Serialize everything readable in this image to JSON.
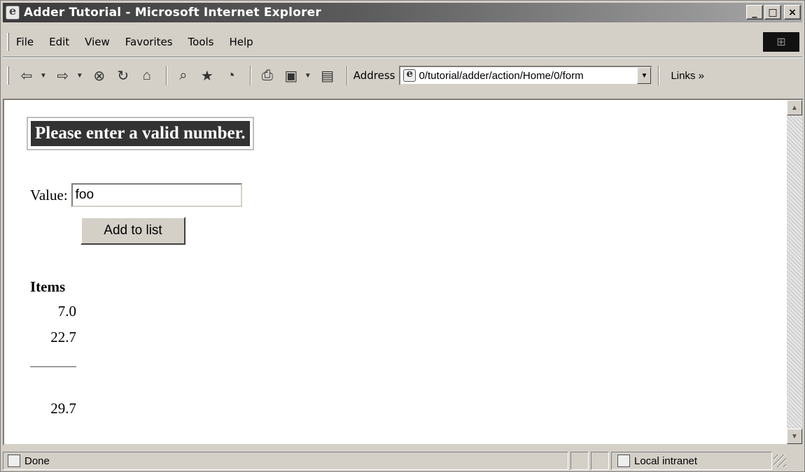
{
  "window": {
    "title": "Adder Tutorial - Microsoft Internet Explorer",
    "minimize_glyph": "_",
    "maximize_glyph": "□",
    "close_glyph": "×"
  },
  "menu": {
    "items": [
      "File",
      "Edit",
      "View",
      "Favorites",
      "Tools",
      "Help"
    ]
  },
  "toolbar": {
    "address_label": "Address",
    "address_value": "0/tutorial/adder/action/Home/0/form",
    "links_label": "Links »"
  },
  "page": {
    "error_message": "Please enter a valid number.",
    "value_label": "Value:",
    "value_input": "foo",
    "add_button": "Add to list",
    "items_heading": "Items",
    "items": [
      "7.0",
      "22.7"
    ],
    "total": "29.7"
  },
  "status": {
    "left": "Done",
    "zone": "Local intranet"
  }
}
